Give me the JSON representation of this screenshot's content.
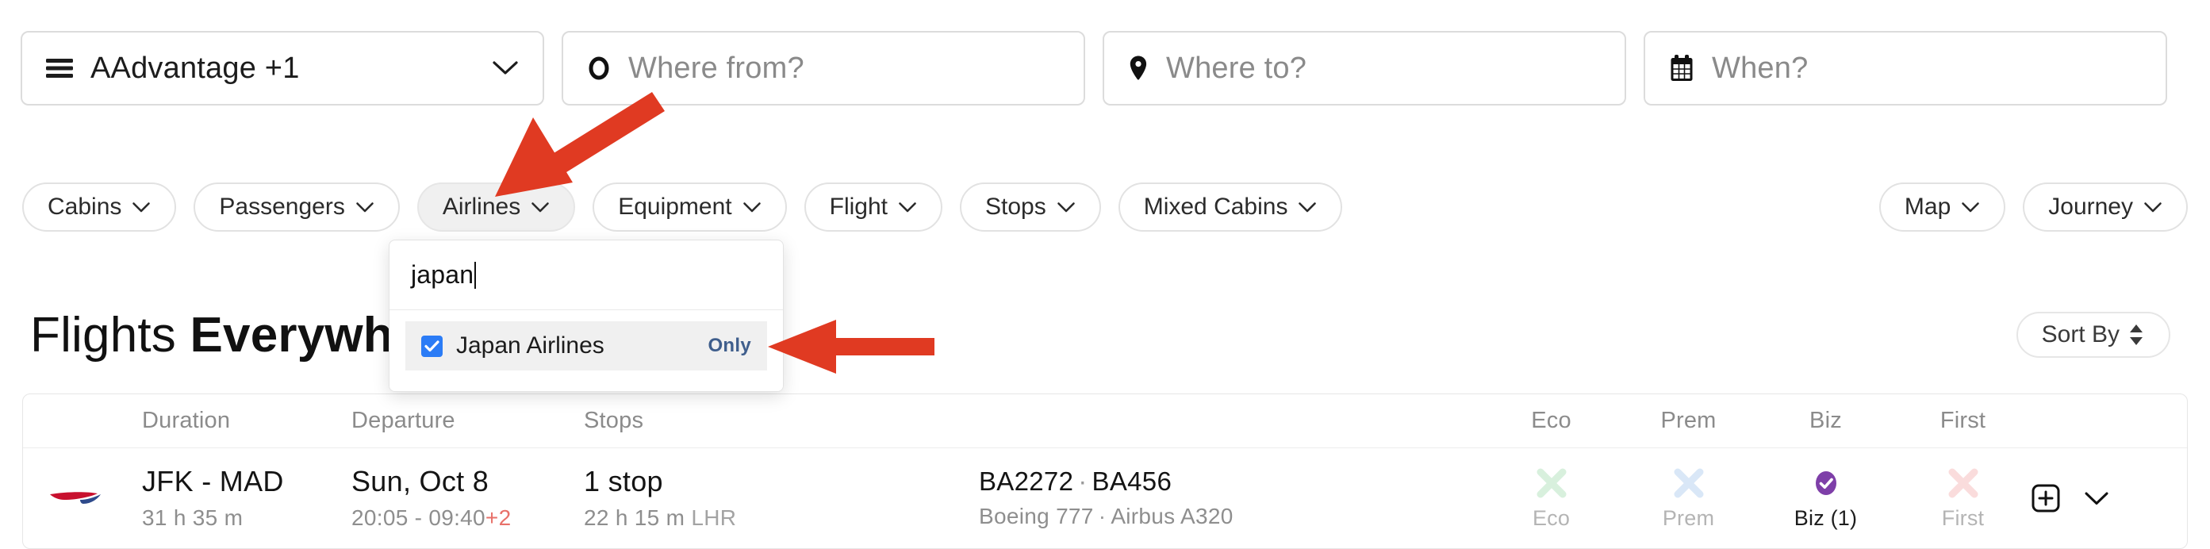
{
  "colors": {
    "accent_red": "#e03a22",
    "checkbox_blue": "#2b7cf6",
    "only_link": "#3f5e8c",
    "biz_purple": "#7e3fa8",
    "eco_x": "#d8f0dd",
    "prem_x": "#d9e7f7",
    "first_x": "#fadcdc",
    "plus_day": "#e8716a"
  },
  "search": {
    "cabin_selector": {
      "label": "AAdvantage +1",
      "icon": "menu-icon",
      "chevron": "chevron-down-icon"
    },
    "origin": {
      "placeholder": "Where from?",
      "value": "",
      "icon": "circle-origin-icon"
    },
    "destination": {
      "placeholder": "Where to?",
      "value": "",
      "icon": "map-pin-icon"
    },
    "dates": {
      "placeholder": "When?",
      "value": "",
      "icon": "calendar-icon"
    }
  },
  "filters": {
    "left": [
      {
        "label": "Cabins",
        "active": false
      },
      {
        "label": "Passengers",
        "active": false
      },
      {
        "label": "Airlines",
        "active": true
      },
      {
        "label": "Equipment",
        "active": false
      },
      {
        "label": "Flight",
        "active": false
      },
      {
        "label": "Stops",
        "active": false
      },
      {
        "label": "Mixed Cabins",
        "active": false
      }
    ],
    "right": [
      {
        "label": "Map",
        "active": false
      },
      {
        "label": "Journey",
        "active": false
      }
    ]
  },
  "airlines_dropdown": {
    "query": "japan",
    "options": [
      {
        "label": "Japan Airlines",
        "checked": true,
        "only_label": "Only"
      }
    ]
  },
  "page": {
    "title_thin": "Flights",
    "title_bold": "Everywhere",
    "sort_by": "Sort By"
  },
  "table": {
    "headers": {
      "duration": "Duration",
      "departure": "Departure",
      "stops": "Stops",
      "eco": "Eco",
      "prem": "Prem",
      "biz": "Biz",
      "first": "First"
    },
    "rows": [
      {
        "airline_logo": "british-airways-speedmarque-icon",
        "route": "JFK - MAD",
        "duration": "31 h 35 m",
        "departure_date": "Sun, Oct 8",
        "departure_times": "20:05 - 09:40",
        "day_offset": "+2",
        "stops": "1 stop",
        "layover": "22 h 15 m",
        "layover_airport": "LHR",
        "flight_numbers_1": "BA2272",
        "flight_numbers_sep": "·",
        "flight_numbers_2": "BA456",
        "equipment_1": "Boeing 777",
        "equipment_sep": "·",
        "equipment_2": "Airbus A320",
        "cabins": {
          "eco": {
            "label": "Eco",
            "available": false
          },
          "prem": {
            "label": "Prem",
            "available": false
          },
          "biz": {
            "label": "Biz (1)",
            "available": true
          },
          "first": {
            "label": "First",
            "available": false
          }
        },
        "actions": {
          "add": "add-to-trip-icon",
          "expand": "chevron-down-icon"
        }
      }
    ]
  },
  "annotations": [
    {
      "name": "arrow-pointing-at-airlines-filter",
      "direction": "down-left"
    },
    {
      "name": "arrow-pointing-at-only-link",
      "direction": "left"
    }
  ]
}
